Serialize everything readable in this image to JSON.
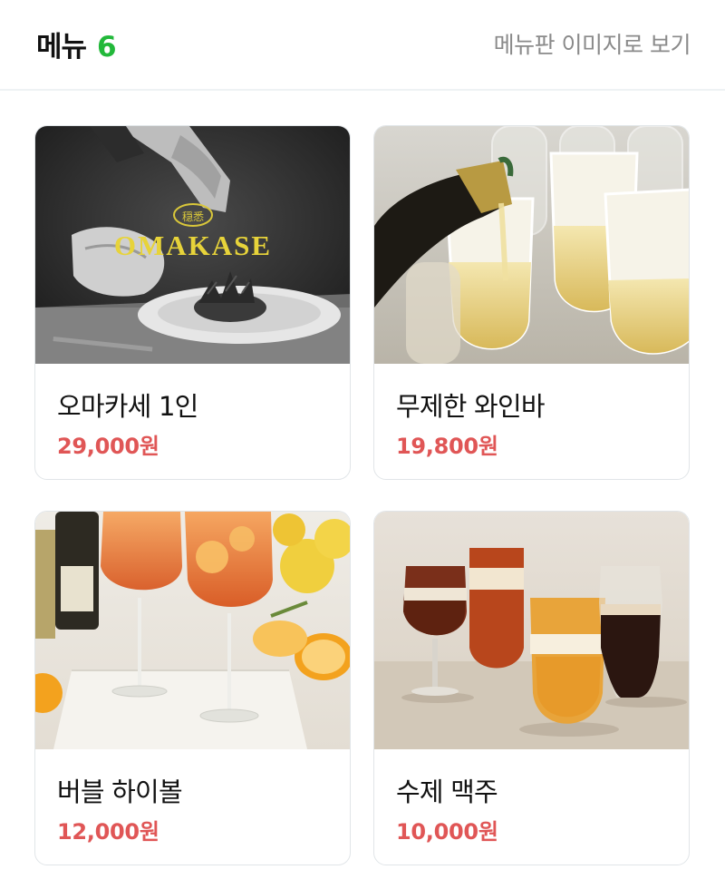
{
  "header": {
    "title": "메뉴",
    "count": "6",
    "view_image_link": "메뉴판 이미지로 보기"
  },
  "menu_items": [
    {
      "name": "오마카세 1인",
      "price": "29,000원",
      "badge_top": "穏悉",
      "badge_text": "OMAKASE"
    },
    {
      "name": "무제한 와인바",
      "price": "19,800원"
    },
    {
      "name": "버블 하이볼",
      "price": "12,000원"
    },
    {
      "name": "수제 맥주",
      "price": "10,000원"
    }
  ],
  "colors": {
    "accent_green": "#22b83a",
    "price_red": "#e05656",
    "link_gray": "#8a8a8a"
  }
}
